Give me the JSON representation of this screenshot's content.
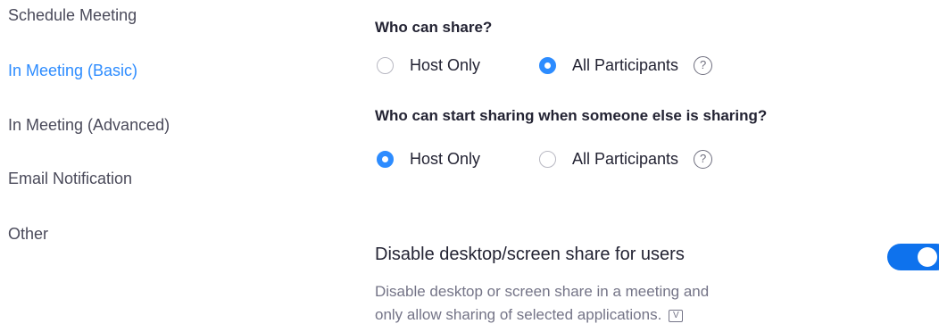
{
  "sidebar": {
    "items": [
      {
        "label": "Schedule Meeting"
      },
      {
        "label": "In Meeting (Basic)",
        "active": true
      },
      {
        "label": "In Meeting (Advanced)"
      },
      {
        "label": "Email Notification"
      },
      {
        "label": "Other"
      }
    ]
  },
  "sharing": {
    "who_can_share": {
      "title": "Who can share?",
      "options": [
        "Host Only",
        "All Participants"
      ],
      "selected": "All Participants"
    },
    "who_can_start": {
      "title": "Who can start sharing when someone else is sharing?",
      "options": [
        "Host Only",
        "All Participants"
      ],
      "selected": "Host Only"
    },
    "help_glyph": "?"
  },
  "disable_share": {
    "title": "Disable desktop/screen share for users",
    "description": "Disable desktop or screen share in a meeting and only allow sharing of selected applications.",
    "version_glyph": "V",
    "enabled": true
  },
  "colors": {
    "accent": "#2d8cff",
    "toggle_on": "#0e72ed"
  },
  "icons": {
    "help": "question-circle-icon",
    "version": "version-badge-icon"
  }
}
